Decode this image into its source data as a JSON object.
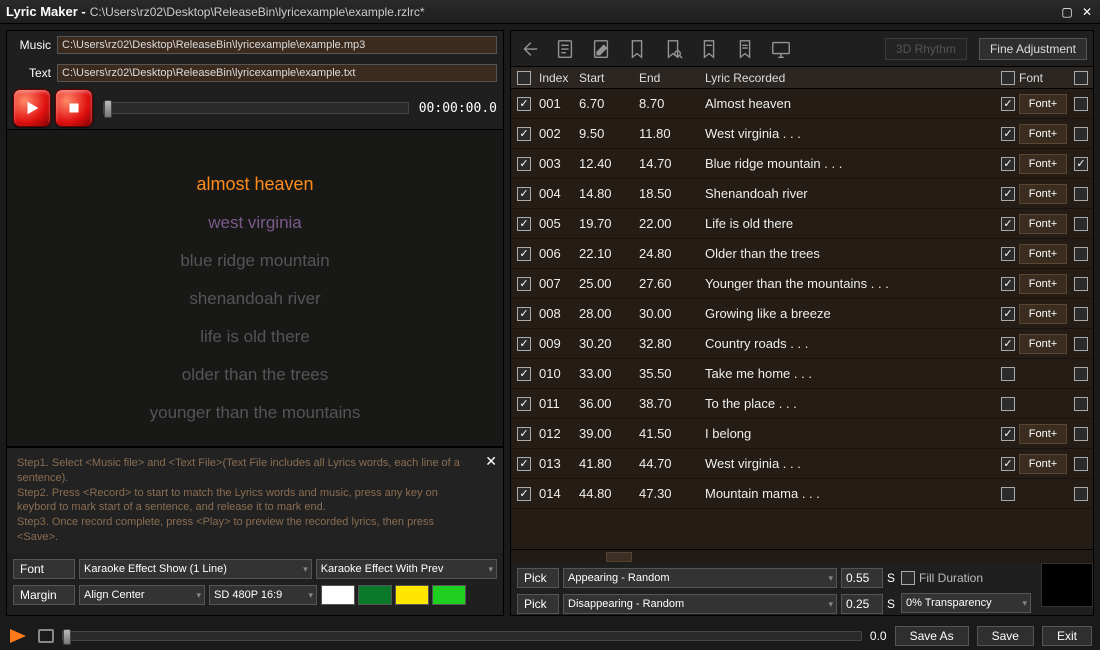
{
  "title_app": "Lyric Maker - ",
  "title_path": "C:\\Users\\rz02\\Desktop\\ReleaseBin\\lyricexample\\example.rzlrc*",
  "music_label": "Music",
  "text_label": "Text",
  "music_path": "C:\\Users\\rz02\\Desktop\\ReleaseBin\\lyricexample\\example.mp3",
  "text_path": "C:\\Users\\rz02\\Desktop\\ReleaseBin\\lyricexample\\example.txt",
  "timecode": "00:00:00.0",
  "preview_lines": [
    "almost heaven",
    "west virginia",
    "blue ridge mountain",
    "shenandoah river",
    "life is old there",
    "older than the trees",
    "younger than the mountains"
  ],
  "help_steps": [
    "Step1. Select <Music file> and <Text File>(Text File includes all Lyrics words, each line of a sentence).",
    "Step2. Press <Record> to start to match the Lyrics words and music, press any key on keybord to mark start of a sentence, and release it to mark end.",
    "Step3. Once record complete, press <Play> to preview the recorded lyrics, then press <Save>."
  ],
  "font_label": "Font",
  "font_effect1": "Karaoke Effect Show (1 Line)",
  "font_effect2": "Karaoke Effect With Prev",
  "margin_label": "Margin",
  "margin_align": "Align Center",
  "margin_res": "SD 480P 16:9",
  "swatches": [
    "#ffffff",
    "#0a7a2a",
    "#ffe600",
    "#20d020"
  ],
  "toolbar_3d": "3D Rhythm",
  "toolbar_fine": "Fine Adjustment",
  "head_index": "Index",
  "head_start": "Start",
  "head_end": "End",
  "head_lyric": "Lyric Recorded",
  "head_font": "Font",
  "rows": [
    {
      "i": "001",
      "s": "6.70",
      "e": "8.70",
      "t": "Almost heaven",
      "chk": true,
      "fchk": true,
      "font": true,
      "tail": false
    },
    {
      "i": "002",
      "s": "9.50",
      "e": "11.80",
      "t": "West virginia . . .",
      "chk": true,
      "fchk": true,
      "font": true,
      "tail": false
    },
    {
      "i": "003",
      "s": "12.40",
      "e": "14.70",
      "t": "Blue ridge mountain . . .",
      "chk": true,
      "fchk": true,
      "font": true,
      "tail": true
    },
    {
      "i": "004",
      "s": "14.80",
      "e": "18.50",
      "t": "Shenandoah river",
      "chk": true,
      "fchk": true,
      "font": true,
      "tail": false
    },
    {
      "i": "005",
      "s": "19.70",
      "e": "22.00",
      "t": "Life is old there",
      "chk": true,
      "fchk": true,
      "font": true,
      "tail": false
    },
    {
      "i": "006",
      "s": "22.10",
      "e": "24.80",
      "t": "Older than the trees",
      "chk": true,
      "fchk": true,
      "font": true,
      "tail": false
    },
    {
      "i": "007",
      "s": "25.00",
      "e": "27.60",
      "t": "Younger than the mountains . . .",
      "chk": true,
      "fchk": true,
      "font": true,
      "tail": false
    },
    {
      "i": "008",
      "s": "28.00",
      "e": "30.00",
      "t": "Growing like a breeze",
      "chk": true,
      "fchk": true,
      "font": true,
      "tail": false
    },
    {
      "i": "009",
      "s": "30.20",
      "e": "32.80",
      "t": "Country roads . . .",
      "chk": true,
      "fchk": true,
      "font": true,
      "tail": false
    },
    {
      "i": "010",
      "s": "33.00",
      "e": "35.50",
      "t": "Take me home . . .",
      "chk": true,
      "fchk": false,
      "font": false,
      "tail": false
    },
    {
      "i": "011",
      "s": "36.00",
      "e": "38.70",
      "t": "To the place . . .",
      "chk": true,
      "fchk": false,
      "font": false,
      "tail": false
    },
    {
      "i": "012",
      "s": "39.00",
      "e": "41.50",
      "t": "I belong",
      "chk": true,
      "fchk": true,
      "font": true,
      "tail": false
    },
    {
      "i": "013",
      "s": "41.80",
      "e": "44.70",
      "t": "West virginia . . .",
      "chk": true,
      "fchk": true,
      "font": true,
      "tail": false
    },
    {
      "i": "014",
      "s": "44.80",
      "e": "47.30",
      "t": "Mountain mama . . .",
      "chk": true,
      "fchk": false,
      "font": false,
      "tail": false
    }
  ],
  "font_plus": "Font+",
  "pick_label": "Pick",
  "pick1_val": "Appearing - Random",
  "pick1_num": "0.55",
  "pick2_val": "Disappearing - Random",
  "pick2_num": "0.25",
  "s_suffix": "S",
  "fill_duration": "Fill Duration",
  "transparency": "0% Transparency",
  "footer_pos": "0.0",
  "btn_saveas": "Save As",
  "btn_save": "Save",
  "btn_exit": "Exit"
}
